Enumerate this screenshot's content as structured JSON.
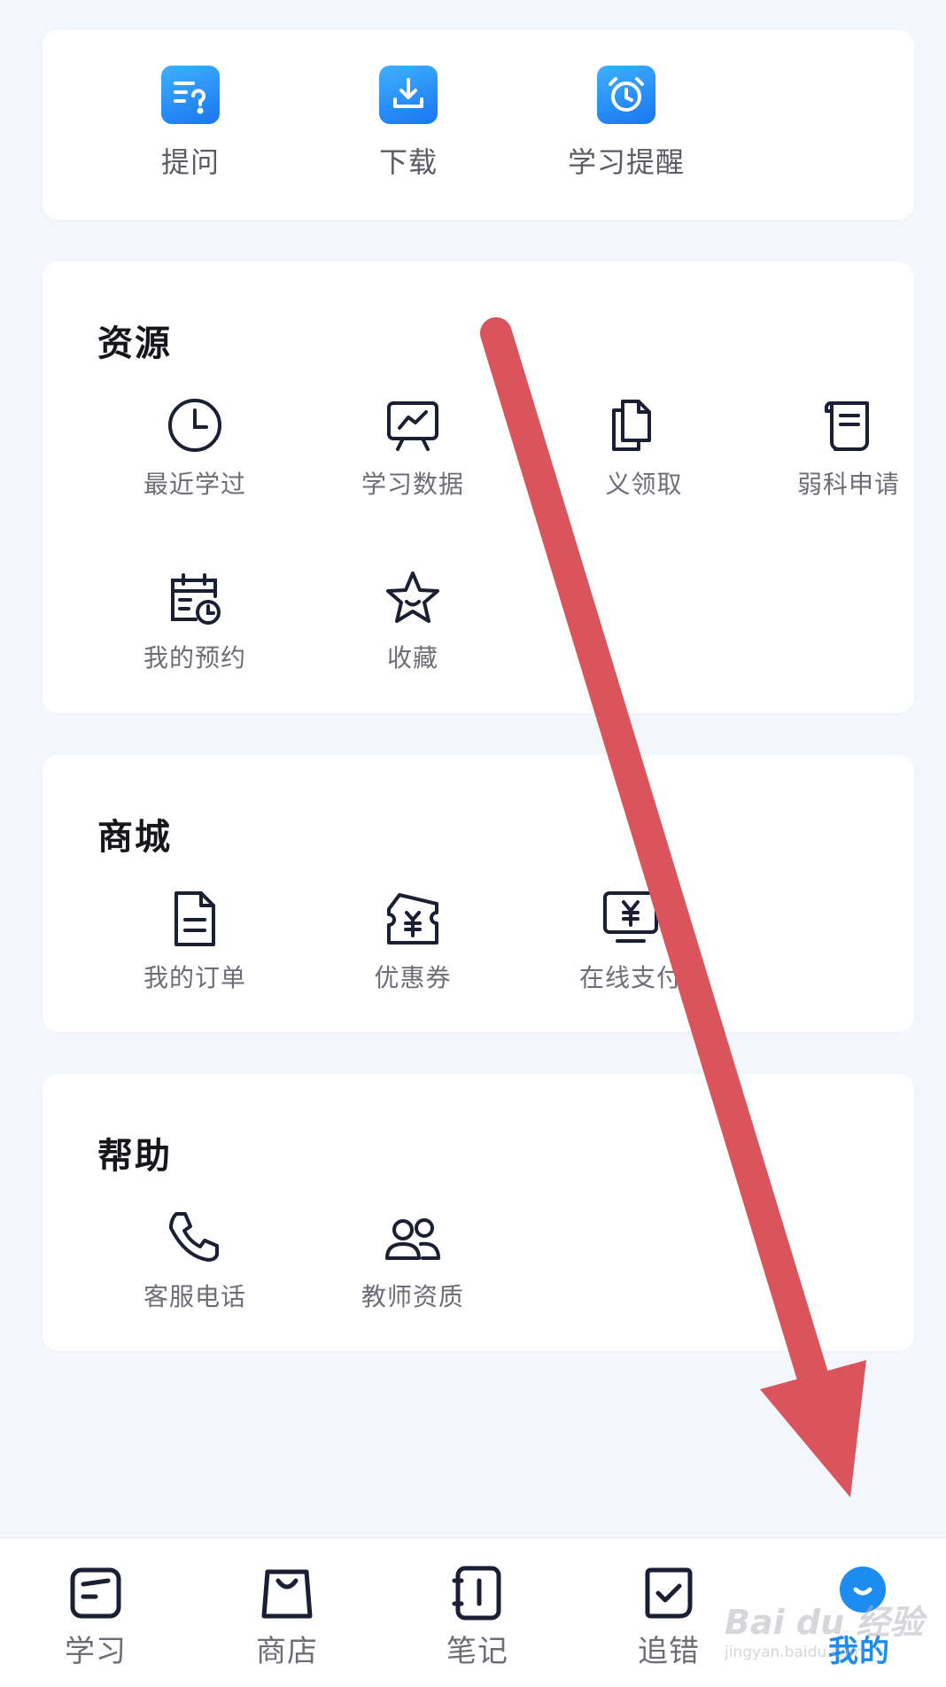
{
  "quick_actions": [
    {
      "label": "提问",
      "icon": "question-doc-icon"
    },
    {
      "label": "下载",
      "icon": "download-icon"
    },
    {
      "label": "学习提醒",
      "icon": "alarm-clock-icon"
    }
  ],
  "sections": {
    "resources": {
      "title": "资源",
      "items": [
        {
          "label": "最近学过",
          "icon": "clock-icon"
        },
        {
          "label": "学习数据",
          "icon": "chart-board-icon"
        },
        {
          "label": "义领取",
          "icon": "documents-icon"
        },
        {
          "label": "弱科申请",
          "icon": "scroll-icon"
        },
        {
          "label": "我的预约",
          "icon": "calendar-clock-icon"
        },
        {
          "label": "收藏",
          "icon": "star-icon"
        }
      ]
    },
    "shop": {
      "title": "商城",
      "items": [
        {
          "label": "我的订单",
          "icon": "order-doc-icon"
        },
        {
          "label": "优惠券",
          "icon": "coupon-icon"
        },
        {
          "label": "在线支付",
          "icon": "payment-monitor-icon"
        }
      ]
    },
    "help": {
      "title": "帮助",
      "items": [
        {
          "label": "客服电话",
          "icon": "phone-icon"
        },
        {
          "label": "教师资质",
          "icon": "people-icon"
        }
      ]
    }
  },
  "tabbar": {
    "active": "我的",
    "tabs": [
      {
        "label": "学习",
        "icon": "study-tab-icon"
      },
      {
        "label": "商店",
        "icon": "shop-bag-icon"
      },
      {
        "label": "笔记",
        "icon": "notebook-icon"
      },
      {
        "label": "追错",
        "icon": "check-tab-icon"
      },
      {
        "label": "我的",
        "icon": "profile-face-icon"
      }
    ]
  },
  "watermark": {
    "main": "Bai du 经验",
    "sub": "jingyan.baidu.com"
  },
  "colors": {
    "accent": "#1d8cf0",
    "arrow": "#d9545b",
    "icon_stroke": "#1b1f33"
  }
}
